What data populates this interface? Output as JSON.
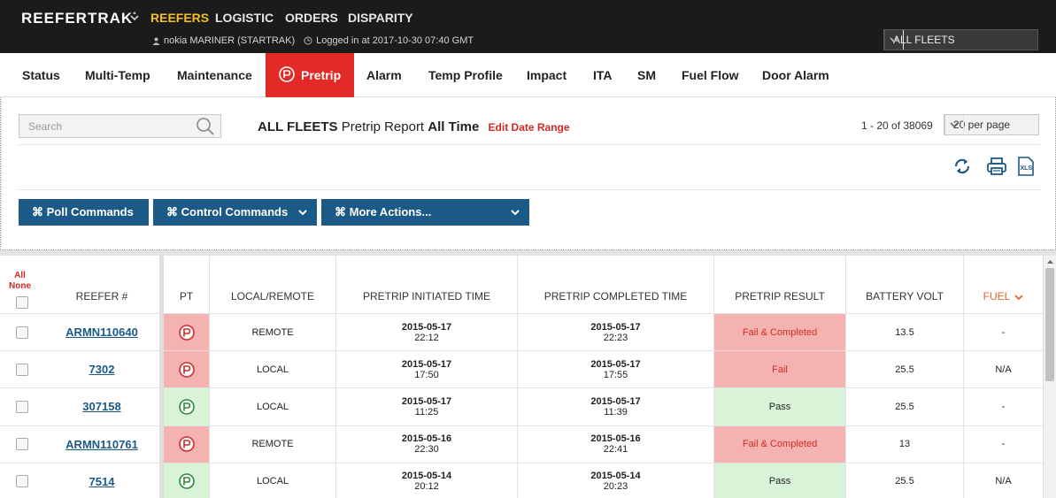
{
  "brand": "REEFERTRAK",
  "brand_mark": "°",
  "topnav": [
    "REEFERS",
    "LOGISTIC",
    "ORDERS",
    "DISPARITY"
  ],
  "user": "nokia MARINER (STARTRAK)",
  "login": "Logged in at 2017-10-30 07:40 GMT",
  "fleet": "ALL FLEETS",
  "tabs": [
    "Status",
    "Multi-Temp",
    "Maintenance",
    "Pretrip",
    "Alarm",
    "Temp Profile",
    "Impact",
    "ITA",
    "SM",
    "Fuel Flow",
    "Door Alarm"
  ],
  "search_placeholder": "Search",
  "report": {
    "fleet": "ALL FLEETS",
    "name": "Pretrip Report",
    "period": "All Time",
    "edit": "Edit Date Range"
  },
  "page_range": "1 - 20 of 38069",
  "per_page": "20 per page",
  "actions": [
    "⌘ Poll Commands",
    "⌘ Control Commands",
    "⌘ More Actions..."
  ],
  "select_all": "All",
  "select_none": "None",
  "columns": [
    "REEFER #",
    "PT",
    "LOCAL/REMOTE",
    "PRETRIP INITIATED TIME",
    "PRETRIP COMPLETED TIME",
    "PRETRIP RESULT",
    "BATTERY VOLT",
    "FUEL"
  ],
  "rows": [
    {
      "reefer": "ARMN110640",
      "status": "fail",
      "mode": "REMOTE",
      "init_date": "2015-05-17",
      "init_time": "22:12",
      "comp_date": "2015-05-17",
      "comp_time": "22:23",
      "result": "Fail & Completed",
      "battery": "13.5",
      "fuel": "-"
    },
    {
      "reefer": "7302",
      "status": "fail",
      "mode": "LOCAL",
      "init_date": "2015-05-17",
      "init_time": "17:50",
      "comp_date": "2015-05-17",
      "comp_time": "17:55",
      "result": "Fail",
      "battery": "25.5",
      "fuel": "N/A"
    },
    {
      "reefer": "307158",
      "status": "pass",
      "mode": "LOCAL",
      "init_date": "2015-05-17",
      "init_time": "11:25",
      "comp_date": "2015-05-17",
      "comp_time": "11:39",
      "result": "Pass",
      "battery": "25.5",
      "fuel": "-"
    },
    {
      "reefer": "ARMN110761",
      "status": "fail",
      "mode": "REMOTE",
      "init_date": "2015-05-16",
      "init_time": "22:30",
      "comp_date": "2015-05-16",
      "comp_time": "22:41",
      "result": "Fail & Completed",
      "battery": "13",
      "fuel": "-"
    },
    {
      "reefer": "7514",
      "status": "pass",
      "mode": "LOCAL",
      "init_date": "2015-05-14",
      "init_time": "20:12",
      "comp_date": "2015-05-14",
      "comp_time": "20:23",
      "result": "Pass",
      "battery": "25.5",
      "fuel": "N/A"
    }
  ],
  "colors": {
    "topbar": "#1b1b1b",
    "active_nav": "#f2c02c",
    "active_tab": "#e22a26",
    "button": "#1b5a87",
    "fail_bg": "#f4b3b1",
    "pass_bg": "#d9f3d9",
    "fail_text": "#d22a26"
  }
}
